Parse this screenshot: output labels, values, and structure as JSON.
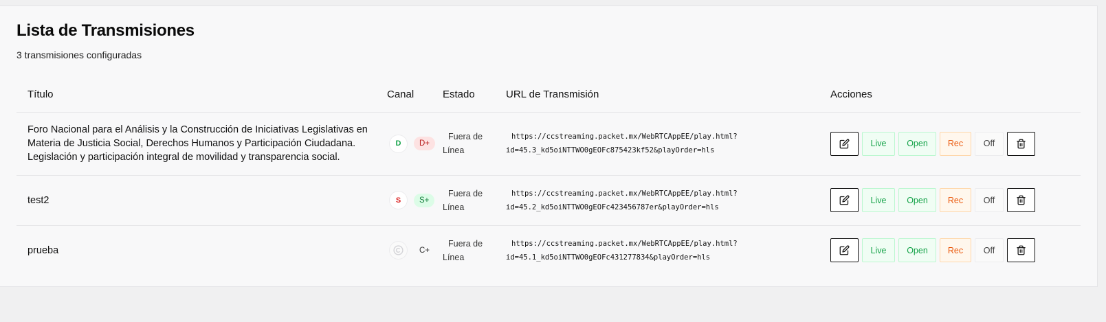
{
  "header": {
    "title": "Lista de Transmisiones",
    "subtitle": "3 transmisiones configuradas"
  },
  "table": {
    "columns": [
      "Título",
      "Canal",
      "Estado",
      "URL de Transmisión",
      "Acciones"
    ],
    "rows": [
      {
        "title": "Foro Nacional para el Análisis y la Construcción de Iniciativas Legislativas en Materia de Justicia Social, Derechos Humanos y Participación Ciudadana. Legislación y participación integral de movilidad y transparencia social.",
        "channel_letter": "D",
        "channel_badge": "D+",
        "status_line1": "Fuera de",
        "status_line2": "Línea",
        "url_line1": "https://ccstreaming.packet.mx/WebRTCAppEE/play.html?",
        "url_line2": "id=45.3_kd5oiNTTWO0gEOFc875423kf52&playOrder=hls"
      },
      {
        "title": "test2",
        "channel_letter": "S",
        "channel_badge": "S+",
        "status_line1": "Fuera de",
        "status_line2": "Línea",
        "url_line1": "https://ccstreaming.packet.mx/WebRTCAppEE/play.html?",
        "url_line2": "id=45.2_kd5oiNTTWO0gEOFc423456787er&playOrder=hls"
      },
      {
        "title": "prueba",
        "channel_letter": "",
        "channel_badge": "C+",
        "status_line1": "Fuera de",
        "status_line2": "Línea",
        "url_line1": "https://ccstreaming.packet.mx/WebRTCAppEE/play.html?",
        "url_line2": "id=45.1_kd5oiNTTWO0gEOFc431277834&playOrder=hls"
      }
    ]
  },
  "actions": {
    "live": "Live",
    "open": "Open",
    "rec": "Rec",
    "off": "Off",
    "edit_icon": "edit-icon",
    "delete_icon": "trash-icon"
  },
  "colors": {
    "green": "#16a34a",
    "red": "#dc2626",
    "orange": "#ea580c"
  }
}
